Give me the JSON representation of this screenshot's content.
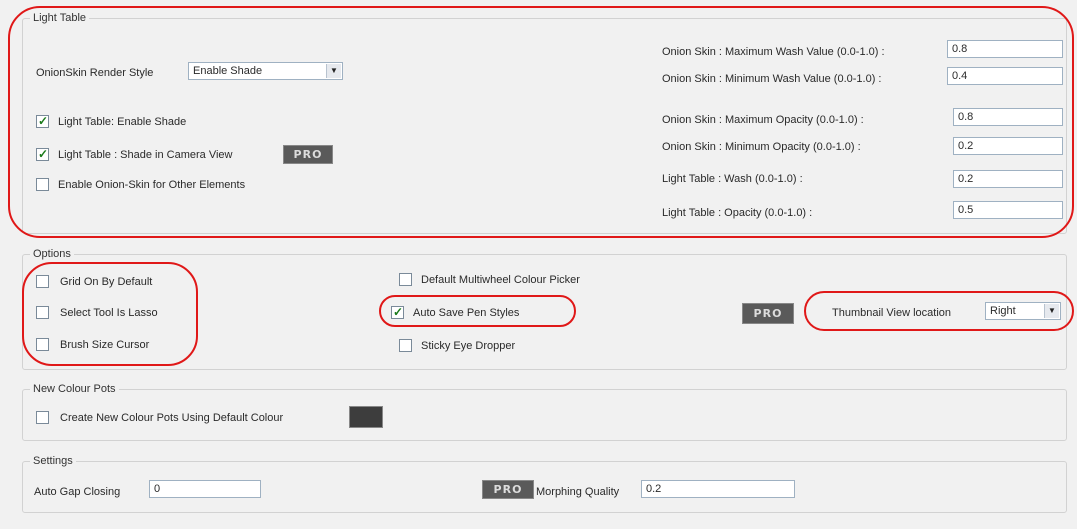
{
  "light_table": {
    "legend": "Light Table",
    "render_style_label": "OnionSkin Render Style",
    "render_style_value": "Enable Shade",
    "enable_shade": {
      "label": "Light Table: Enable Shade",
      "checked": true
    },
    "shade_camera": {
      "label": "Light Table : Shade in Camera View",
      "checked": true
    },
    "onion_other": {
      "label": "Enable Onion-Skin for Other Elements",
      "checked": false
    },
    "fields": [
      {
        "label": "Onion Skin : Maximum Wash Value (0.0-1.0) :",
        "value": "0.8"
      },
      {
        "label": "Onion Skin : Minimum Wash Value (0.0-1.0) :",
        "value": "0.4"
      },
      {
        "label": "Onion Skin : Maximum Opacity (0.0-1.0) :",
        "value": "0.8"
      },
      {
        "label": "Onion Skin : Minimum Opacity (0.0-1.0) :",
        "value": "0.2"
      },
      {
        "label": "Light Table : Wash (0.0-1.0) :",
        "value": "0.2"
      },
      {
        "label": "Light Table : Opacity (0.0-1.0) :",
        "value": "0.5"
      }
    ]
  },
  "options": {
    "legend": "Options",
    "grid_on": {
      "label": "Grid On By Default",
      "checked": false
    },
    "select_lasso": {
      "label": "Select Tool Is Lasso",
      "checked": false
    },
    "brush_cursor": {
      "label": "Brush Size Cursor",
      "checked": false
    },
    "multiwheel": {
      "label": "Default Multiwheel Colour Picker",
      "checked": false
    },
    "auto_save_pen": {
      "label": "Auto Save Pen Styles",
      "checked": true
    },
    "sticky_eye": {
      "label": "Sticky Eye Dropper",
      "checked": false
    },
    "thumbnail_label": "Thumbnail View location",
    "thumbnail_value": "Right"
  },
  "colour_pots": {
    "legend": "New Colour Pots",
    "create_default": {
      "label": "Create New Colour Pots Using Default Colour",
      "checked": false
    },
    "swatch_color": "#3d3d3d"
  },
  "settings": {
    "legend": "Settings",
    "gap_label": "Auto Gap Closing",
    "gap_value": "0",
    "morph_label": "Morphing Quality",
    "morph_value": "0.2"
  },
  "pro_badge": "PRO",
  "highlight_color": "#e01818"
}
